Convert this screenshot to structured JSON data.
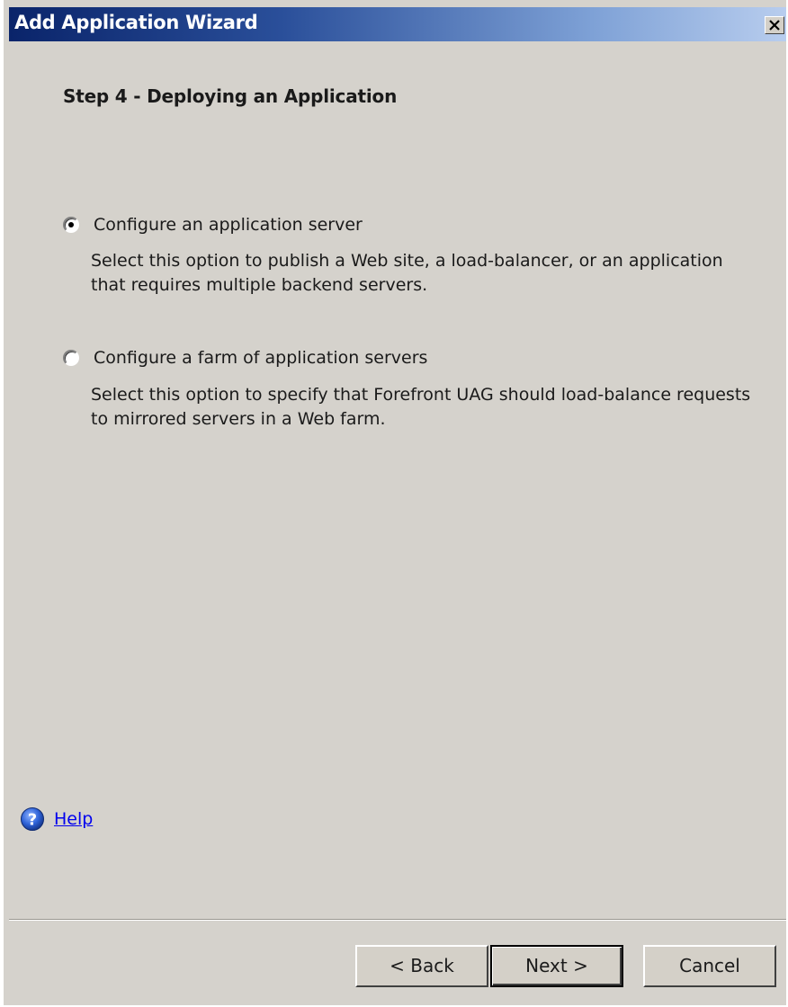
{
  "window": {
    "title": "Add Application Wizard",
    "close_icon": "close-icon"
  },
  "step": {
    "title": "Step 4 - Deploying an Application"
  },
  "options": [
    {
      "label": "Configure an application server",
      "description": "Select this option to publish a Web site, a load-balancer, or an application that requires multiple backend servers.",
      "selected": true
    },
    {
      "label": "Configure a farm of application servers",
      "description": "Select this option to specify that Forefront UAG should load-balance requests to mirrored servers in a Web farm.",
      "selected": false
    }
  ],
  "help": {
    "icon": "help-icon",
    "label": "Help"
  },
  "buttons": {
    "back": "< Back",
    "next": "Next >",
    "cancel": "Cancel"
  },
  "colors": {
    "titlebar_start": "#0a246a",
    "titlebar_end": "#b8cdee",
    "dialog_background": "#d5d2cc",
    "link": "#0000ee"
  }
}
